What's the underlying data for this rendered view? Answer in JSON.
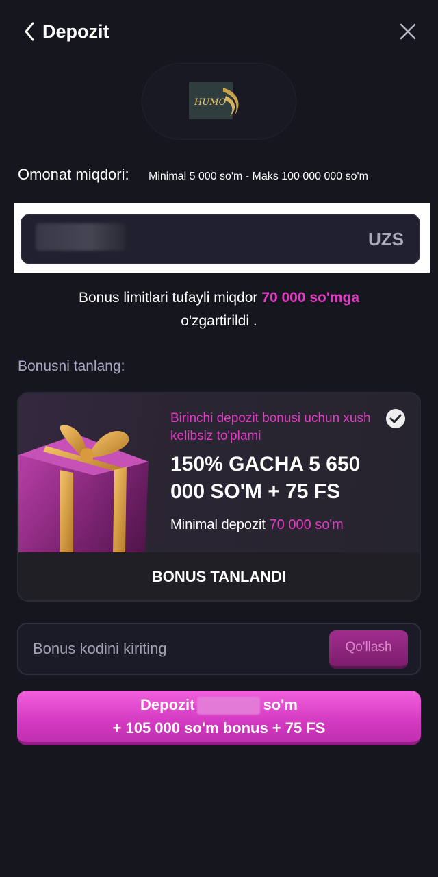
{
  "header": {
    "title": "Depozit"
  },
  "payment_method": {
    "logo_text": "HUMO"
  },
  "amount": {
    "label": "Omonat miqdori:",
    "limits": "Minimal 5 000 so'm - Maks 100 000 000 so'm",
    "currency": "UZS"
  },
  "notice": {
    "text_before": "Bonus limitlari tufayli miqdor",
    "highlight": "70 000 so'mga",
    "text_after": "o'zgartirildi ."
  },
  "bonus": {
    "heading": "Bonusni tanlang:",
    "intro": "Birinchi depozit bonusi uchun xush kelibsiz to'plami",
    "title": "150% GACHA 5 650 000 SO'M + 75 FS",
    "min_label": "Minimal depozit",
    "min_value": "70 000 so'm",
    "selected_label": "BONUS TANLANDI"
  },
  "promo": {
    "placeholder": "Bonus kodini kiriting",
    "apply_label": "Qo'llash"
  },
  "deposit_button": {
    "prefix": "Depozit",
    "suffix": "so'm",
    "line2": "+ 105 000 so'm bonus + 75 FS"
  },
  "colors": {
    "background": "#16161f",
    "accent_pink": "#e23ac3",
    "button_pink": "#d43ac2"
  }
}
